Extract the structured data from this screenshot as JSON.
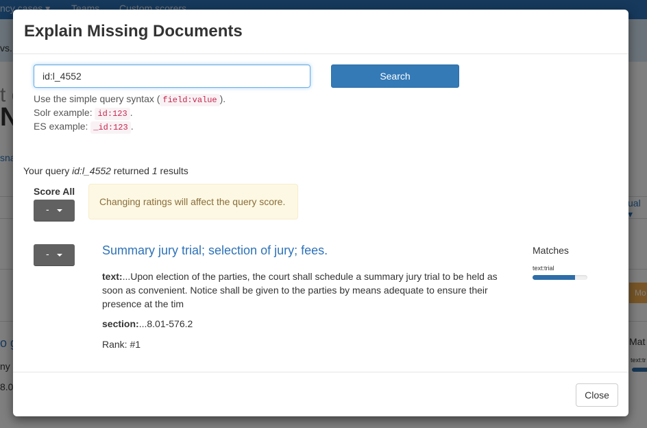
{
  "background": {
    "nav": [
      "ncy cases ▾",
      "Teams",
      "Custom scorers"
    ],
    "bar_text": "vs. T",
    "fragments": {
      "t_big": "t c",
      "ne_big": "Ne",
      "sna": "sna",
      "ual": "ual ▾",
      "mo": "Mo",
      "o_g": "o g",
      "ny": "ny",
      "eight": "8.0",
      "mat": "Mat",
      "text_tr": "text:tr"
    }
  },
  "modal": {
    "title": "Explain Missing Documents",
    "search": {
      "value": "id:l_4552",
      "button_label": "Search"
    },
    "help": {
      "line1_prefix": "Use the simple query syntax (",
      "line1_code": "field:value",
      "line1_suffix": ").",
      "line2_prefix": "Solr example:",
      "line2_code": "id:123",
      "line2_suffix": ".",
      "line3_prefix": "ES example:",
      "line3_code": "_id:123",
      "line3_suffix": "."
    },
    "summary": {
      "prefix": "Your query ",
      "query": "id:l_4552",
      "middle": " returned ",
      "count": "1",
      "suffix": " results"
    },
    "score_all": {
      "label": "Score All",
      "dropdown_value": "-"
    },
    "alert": "Changing ratings will affect the query score.",
    "result": {
      "rating_value": "-",
      "title": "Summary jury trial; selection of jury; fees.",
      "text_label": "text:",
      "text_value": "...Upon election of the parties, the court shall schedule a summary jury trial to be held as soon as convenient. Notice shall be given to the parties by means adequate to ensure their presence at the tim",
      "section_label": "section:",
      "section_value": "...8.01-576.2",
      "rank": "Rank: #1",
      "matches_label": "Matches",
      "match_term": "text:trial",
      "match_fraction": 0.78
    },
    "close_label": "Close"
  }
}
